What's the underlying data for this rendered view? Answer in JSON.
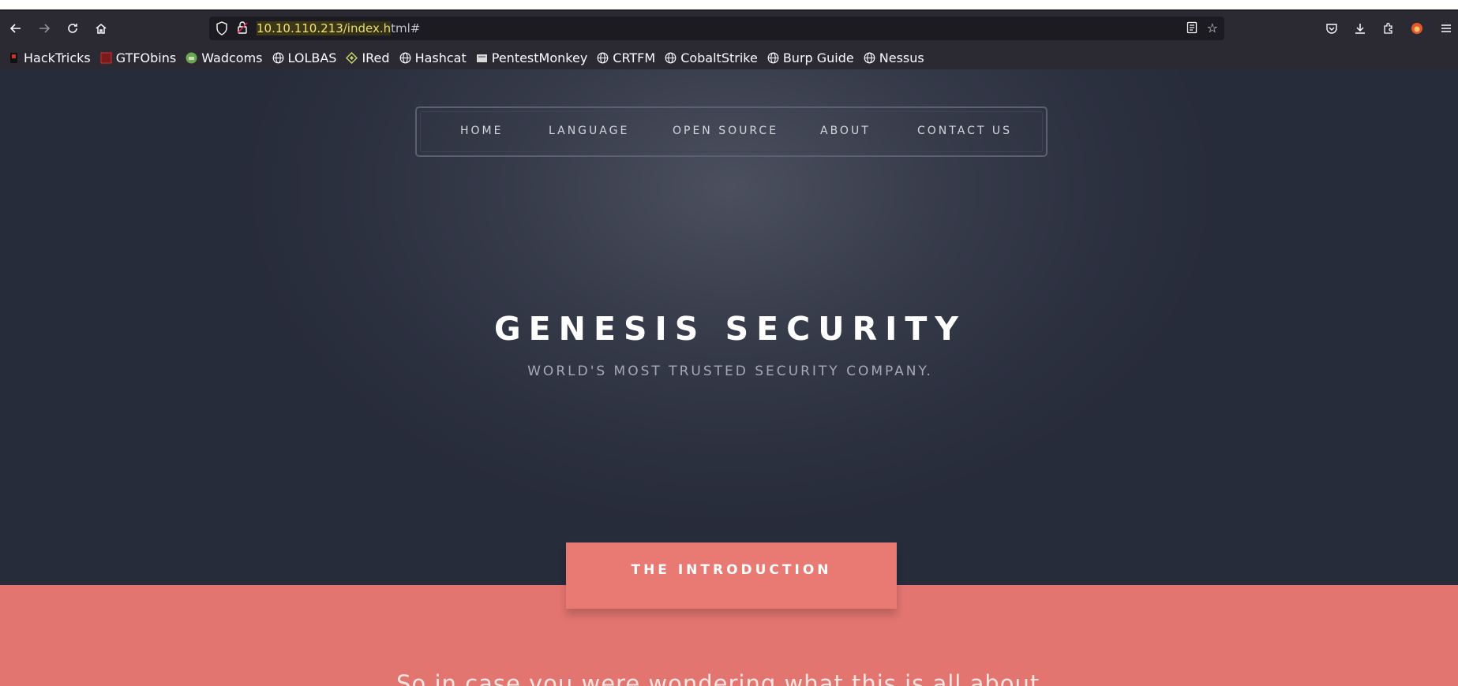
{
  "browser": {
    "url_host": "10.10.110.213",
    "url_path_highlight": "/index.h",
    "url_rest": "tml#"
  },
  "bookmarks": [
    {
      "label": "HackTricks",
      "icon": "hacktricks-icon"
    },
    {
      "label": "GTFObins",
      "icon": "gtfobins-icon"
    },
    {
      "label": "Wadcoms",
      "icon": "wadcoms-icon"
    },
    {
      "label": "LOLBAS",
      "icon": "globe-icon"
    },
    {
      "label": "IRed",
      "icon": "ired-icon"
    },
    {
      "label": "Hashcat",
      "icon": "globe-icon"
    },
    {
      "label": "PentestMonkey",
      "icon": "pentestmonkey-icon"
    },
    {
      "label": "CRTFM",
      "icon": "globe-icon"
    },
    {
      "label": "CobaltStrike",
      "icon": "globe-icon"
    },
    {
      "label": "Burp Guide",
      "icon": "globe-icon"
    },
    {
      "label": "Nessus",
      "icon": "globe-icon"
    }
  ],
  "nav": {
    "home": "HOME",
    "language": "LANGUAGE",
    "open_source": "OPEN SOURCE",
    "about": "ABOUT",
    "contact": "CONTACT US"
  },
  "hero": {
    "title": "GENESIS SECURITY",
    "subtitle": "WORLD'S MOST TRUSTED SECURITY COMPANY."
  },
  "intro": {
    "tab_label": "THE INTRODUCTION",
    "text": "So in case you were wondering what this is all about..."
  },
  "colors": {
    "hero_bg": "#2f3443",
    "intro_band": "#e37570",
    "url_highlight": "#f3e27a"
  }
}
